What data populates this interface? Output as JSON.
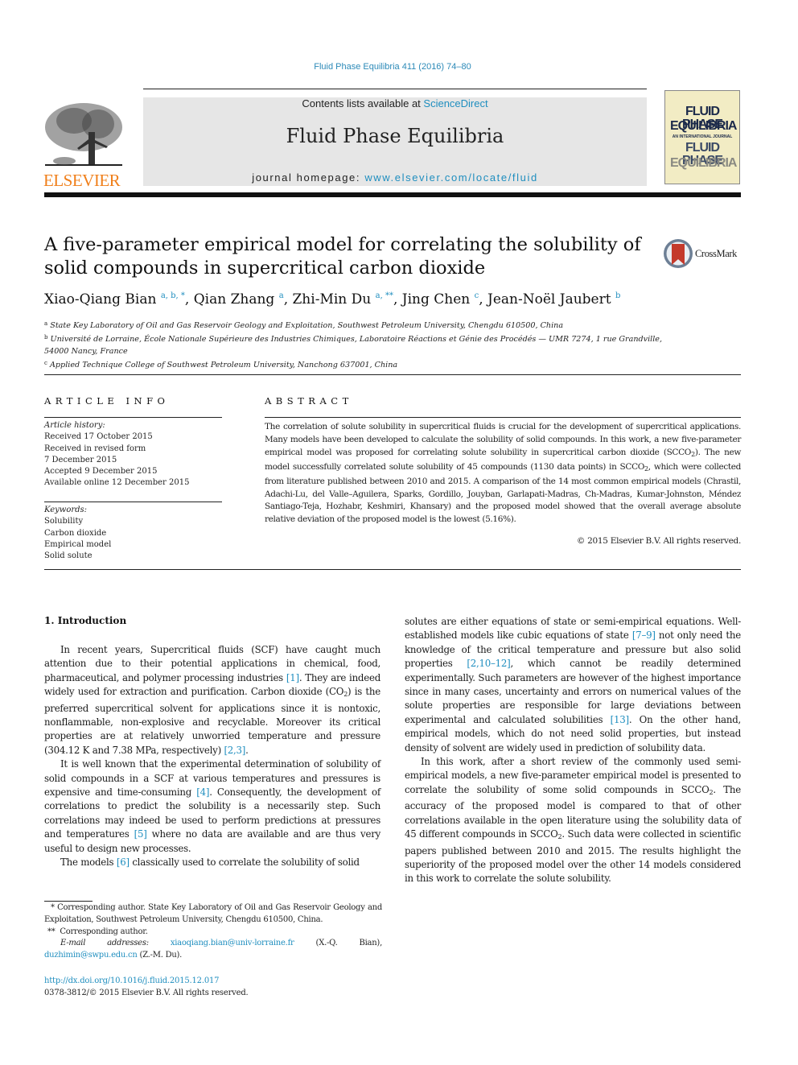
{
  "header": {
    "journal_ref": "Fluid Phase Equilibria 411 (2016) 74–80",
    "publisher_logo_text": "ELSEVIER",
    "contents_prefix": "Contents lists available at ",
    "contents_link": "ScienceDirect",
    "journal_title": "Fluid Phase Equilibria",
    "homepage_prefix": "journal homepage: ",
    "homepage_link": "www.elsevier.com/locate/fluid",
    "cover_lines": [
      "FLUID PHASE",
      "EQUILIBRIA",
      "AN INTERNATIONAL JOURNAL",
      "FLUID PHASE",
      "EQUILIBRIA"
    ],
    "crossmark_label": "CrossMark"
  },
  "article": {
    "title": "A five-parameter empirical model for correlating the solubility of solid compounds in supercritical carbon dioxide",
    "authors": [
      {
        "name": "Xiao-Qiang Bian",
        "marks": "a, b, *"
      },
      {
        "name": "Qian Zhang",
        "marks": "a"
      },
      {
        "name": "Zhi-Min Du",
        "marks": "a, **"
      },
      {
        "name": "Jing Chen",
        "marks": "c"
      },
      {
        "name": "Jean-Noël Jaubert",
        "marks": "b"
      }
    ],
    "affiliations": [
      {
        "mark": "a",
        "text": "State Key Laboratory of Oil and Gas Reservoir Geology and Exploitation, Southwest Petroleum University, Chengdu 610500, China"
      },
      {
        "mark": "b",
        "text": "Université de Lorraine, École Nationale Supérieure des Industries Chimiques, Laboratoire Réactions et Génie des Procédés — UMR 7274, 1 rue Grandville, 54000 Nancy, France"
      },
      {
        "mark": "c",
        "text": "Applied Technique College of Southwest Petroleum University, Nanchong 637001, China"
      }
    ]
  },
  "article_info": {
    "heading": "ARTICLE INFO",
    "history_label": "Article history:",
    "history": [
      "Received 17 October 2015",
      "Received in revised form",
      "7 December 2015",
      "Accepted 9 December 2015",
      "Available online 12 December 2015"
    ],
    "keywords_label": "Keywords:",
    "keywords": [
      "Solubility",
      "Carbon dioxide",
      "Empirical model",
      "Solid solute"
    ]
  },
  "abstract": {
    "heading": "ABSTRACT",
    "text_1": "The correlation of solute solubility in supercritical fluids is crucial for the development of supercritical applications. Many models have been developed to calculate the solubility of solid compounds. In this work, a new five-parameter empirical model was proposed for correlating solute solubility in supercritical carbon dioxide (SCCO",
    "text_2": "). The new model successfully correlated solute solubility of 45 compounds (1130 data points) in SCCO",
    "text_3": ", which were collected from literature published between 2010 and 2015. A comparison of the 14 most common empirical models (Chrastil, Adachi-Lu, del Valle–Aguilera, Sparks, Gordillo, Jouyban, Garlapati-Madras, Ch-Madras, Kumar-Johnston, Méndez Santiago-Teja, Hozhabr, Keshmiri, Khansary) and the proposed model showed that the overall average absolute relative deviation of the proposed model is the lowest (5.16%).",
    "copyright": "© 2015 Elsevier B.V. All rights reserved."
  },
  "body": {
    "section_heading": "1.  Introduction",
    "p1": {
      "a": "In recent years, Supercritical fluids (SCF) have caught much attention due to their potential applications in chemical, food, pharmaceutical, and polymer processing industries ",
      "ref1": "[1]",
      "b": ". They are indeed widely used for extraction and purification. Carbon dioxide (CO",
      "c": ") is the preferred supercritical solvent for applications since it is nontoxic, nonflammable, non-explosive and recyclable. Moreover its critical properties are at relatively unworried temperature and pressure (304.12 K and 7.38 MPa, respectively) ",
      "ref2": "[2,3]",
      "d": "."
    },
    "p2": {
      "a": "It is well known that the experimental determination of solubility of solid compounds in a SCF at various temperatures and pressures is expensive and time-consuming ",
      "ref1": "[4]",
      "b": ". Consequently, the development of correlations to predict the solubility is a necessarily step. Such correlations may indeed be used to perform predictions at pressures and temperatures ",
      "ref2": "[5]",
      "c": " where no data are available and are thus very useful to design new processes."
    },
    "p3": {
      "a": "The models ",
      "ref1": "[6]",
      "b": " classically used to correlate the solubility of solid solutes are either equations of state or semi-empirical equations. Well-established models like cubic equations of state ",
      "ref2": "[7–9]",
      "c": " not only need the knowledge of the critical temperature and pressure but also solid properties ",
      "ref3": "[2,10–12]",
      "d": ", which cannot be readily determined experimentally. Such parameters are however of the highest importance since in many cases, uncertainty and errors on numerical values of the solute properties are responsible for large deviations between experimental and calculated solubilities ",
      "ref4": "[13]",
      "e": ". On the other hand, empirical models, which do not need solid properties, but instead density of solvent are widely used in prediction of solubility data."
    },
    "p4": {
      "a": "In this work, after a short review of the commonly used semi-empirical models, a new five-parameter empirical model is presented to correlate the solubility of some solid compounds in SCCO",
      "b": ". The accuracy of the proposed model is compared to that of other correlations available in the open literature using the solubility data of 45 different compounds in SCCO",
      "c": ". Such data were collected in scientific papers published between 2010 and 2015. The results highlight the superiority of the proposed model over the other 14 models considered in this work to correlate the solute solubility."
    },
    "subscript_2": "2"
  },
  "footnotes": {
    "star_mark": "*",
    "star_text": "Corresponding author. State Key Laboratory of Oil and Gas Reservoir Geology and Exploitation, Southwest Petroleum University, Chengdu 610500, China.",
    "dstar_mark": "**",
    "dstar_text": "Corresponding author.",
    "email_label": "E-mail addresses:",
    "email1": "xiaoqiang.bian@univ-lorraine.fr",
    "email1_who": " (X.-Q. Bian), ",
    "email2": "duzhimin@swpu.edu.cn",
    "email2_who": " (Z.-M. Du).",
    "doi": "http://dx.doi.org/10.1016/j.fluid.2015.12.017",
    "issn_line": "0378-3812/© 2015 Elsevier B.V. All rights reserved."
  },
  "colors": {
    "link": "#1f8ebf",
    "elsevier_orange": "#f07f1a",
    "masthead_bg": "#e6e6e6",
    "cover_bg": "#f2ecc4"
  }
}
